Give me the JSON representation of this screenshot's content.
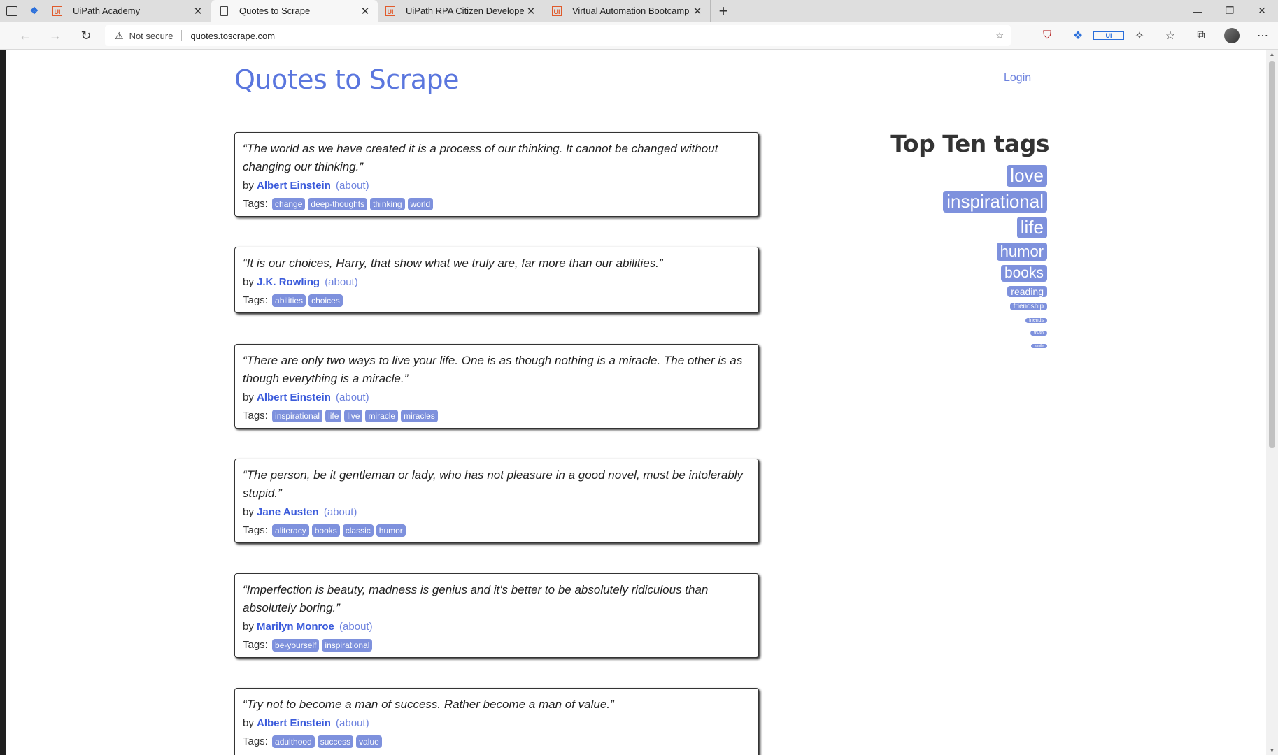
{
  "browser": {
    "tabs": [
      {
        "title": "UiPath Academy",
        "icon": "uipath-icon",
        "active": false
      },
      {
        "title": "Quotes to Scrape",
        "icon": "page-icon",
        "active": true
      },
      {
        "title": "UiPath RPA Citizen Developer Fo",
        "icon": "uipath-icon",
        "active": false
      },
      {
        "title": "Virtual Automation Bootcamp | U",
        "icon": "uipath-icon",
        "active": false
      }
    ],
    "security_label": "Not secure",
    "url": "quotes.toscrape.com"
  },
  "site": {
    "title": "Quotes to Scrape",
    "login": "Login",
    "accent": "#5a76de"
  },
  "quotes": [
    {
      "text": "“The world as we have created it is a process of our thinking. It cannot be changed without changing our thinking.”",
      "by": "by",
      "author": "Albert Einstein",
      "about": "(about)",
      "tags_label": "Tags:",
      "tags": [
        "change",
        "deep-thoughts",
        "thinking",
        "world"
      ]
    },
    {
      "text": "“It is our choices, Harry, that show what we truly are, far more than our abilities.”",
      "by": "by",
      "author": "J.K. Rowling",
      "about": "(about)",
      "tags_label": "Tags:",
      "tags": [
        "abilities",
        "choices"
      ]
    },
    {
      "text": "“There are only two ways to live your life. One is as though nothing is a miracle. The other is as though everything is a miracle.”",
      "by": "by",
      "author": "Albert Einstein",
      "about": "(about)",
      "tags_label": "Tags:",
      "tags": [
        "inspirational",
        "life",
        "live",
        "miracle",
        "miracles"
      ]
    },
    {
      "text": "“The person, be it gentleman or lady, who has not pleasure in a good novel, must be intolerably stupid.”",
      "by": "by",
      "author": "Jane Austen",
      "about": "(about)",
      "tags_label": "Tags:",
      "tags": [
        "aliteracy",
        "books",
        "classic",
        "humor"
      ]
    },
    {
      "text": "“Imperfection is beauty, madness is genius and it's better to be absolutely ridiculous than absolutely boring.”",
      "by": "by",
      "author": "Marilyn Monroe",
      "about": "(about)",
      "tags_label": "Tags:",
      "tags": [
        "be-yourself",
        "inspirational"
      ]
    },
    {
      "text": "“Try not to become a man of success. Rather become a man of value.”",
      "by": "by",
      "author": "Albert Einstein",
      "about": "(about)",
      "tags_label": "Tags:",
      "tags": [
        "adulthood",
        "success",
        "value"
      ]
    }
  ],
  "top_tags": {
    "heading": "Top Ten tags",
    "tags": [
      "love",
      "inspirational",
      "life",
      "humor",
      "books",
      "reading",
      "friendship",
      "friends",
      "truth",
      "simile"
    ]
  }
}
